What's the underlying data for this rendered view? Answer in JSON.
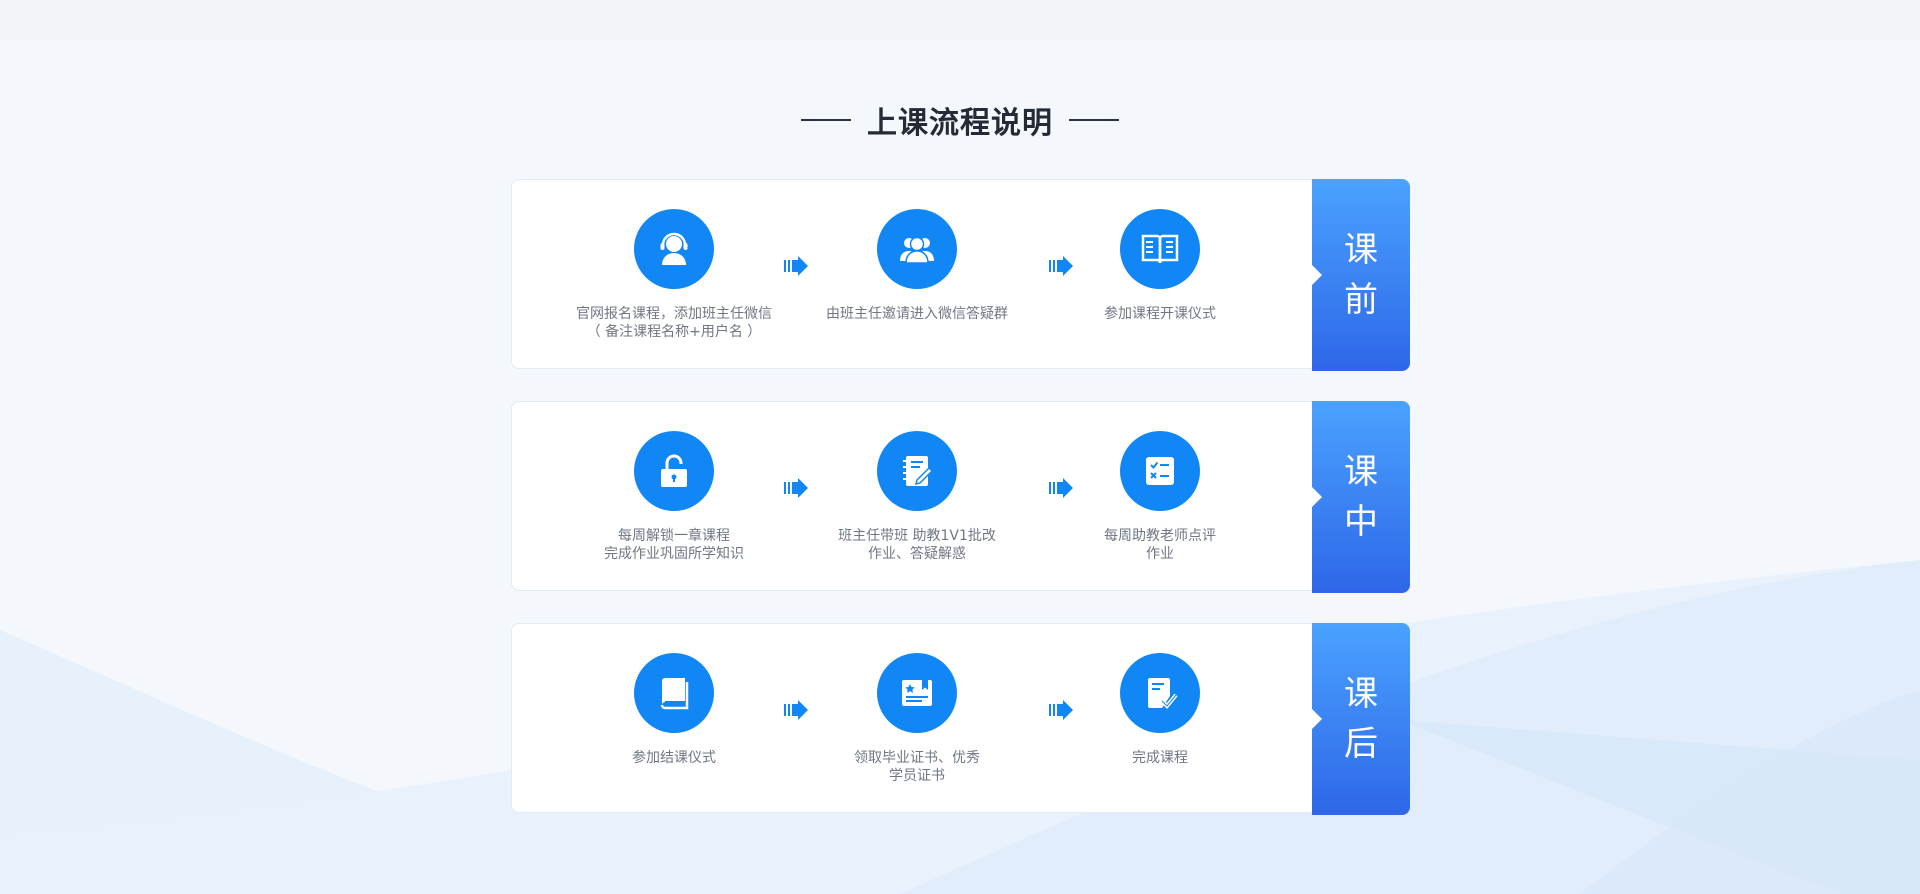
{
  "title": "上课流程说明",
  "colors": {
    "accent": "#1187f5",
    "label_top": "#4aa2ff",
    "label_bottom": "#2e67e8"
  },
  "stages": [
    {
      "label_1": "课",
      "label_2": "前",
      "steps": [
        {
          "icon": "headset-support-icon",
          "text": "官网报名课程，添加班主任微信\n（ 备注课程名称+用户名 ）"
        },
        {
          "icon": "group-users-icon",
          "text": "由班主任邀请进入微信答疑群"
        },
        {
          "icon": "open-book-icon",
          "text": "参加课程开课仪式"
        }
      ]
    },
    {
      "label_1": "课",
      "label_2": "中",
      "steps": [
        {
          "icon": "unlock-icon",
          "text": "每周解锁一章课程\n完成作业巩固所学知识"
        },
        {
          "icon": "notebook-pen-icon",
          "text": "班主任带班 助教1V1批改\n作业、答疑解惑"
        },
        {
          "icon": "checklist-icon",
          "text": "每周助教老师点评\n作业"
        }
      ]
    },
    {
      "label_1": "课",
      "label_2": "后",
      "steps": [
        {
          "icon": "book-icon",
          "text": "参加结课仪式"
        },
        {
          "icon": "certificate-icon",
          "text": "领取毕业证书、优秀\n学员证书"
        },
        {
          "icon": "document-check-icon",
          "text": "完成课程"
        }
      ]
    }
  ]
}
